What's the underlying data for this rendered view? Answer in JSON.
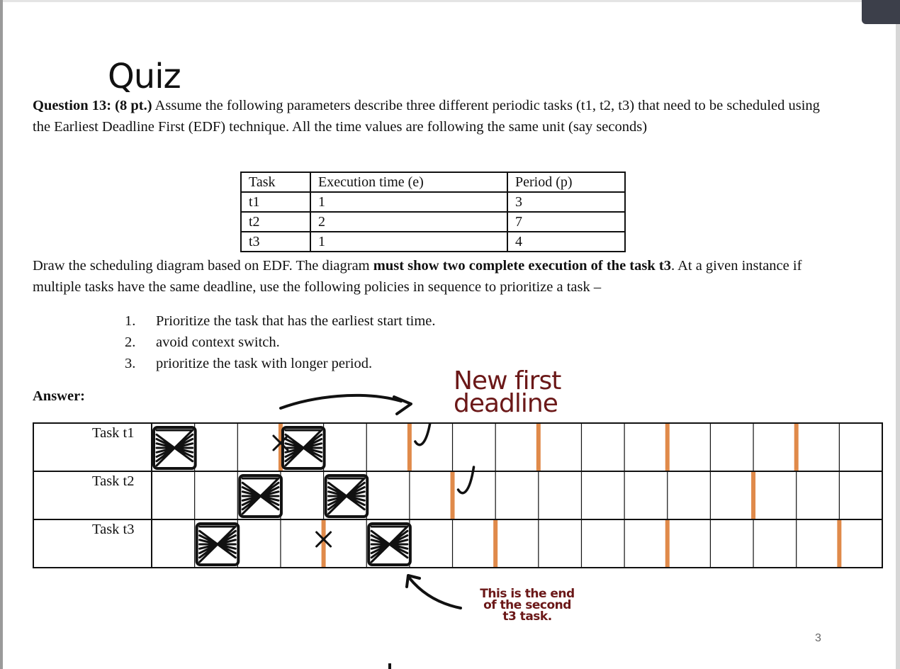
{
  "slide": {
    "title": "Quiz",
    "page_number": "3"
  },
  "question": {
    "label": "Question 13: (8 pt.)",
    "text": " Assume the following parameters describe three different periodic tasks (t1, t2, t3) that need to be scheduled using the Earliest Deadline First (EDF) technique. All the time values are following the same unit (say seconds)"
  },
  "params_table": {
    "headers": [
      "Task",
      "Execution time (e)",
      "Period (p)"
    ],
    "rows": [
      [
        "t1",
        "1",
        "3"
      ],
      [
        "t2",
        "2",
        "7"
      ],
      [
        "t3",
        "1",
        "4"
      ]
    ]
  },
  "instructions": {
    "part1": "Draw the scheduling diagram based on EDF. The diagram ",
    "bold": "must show two complete execution of the task t3",
    "part2": ". At a given instance if multiple tasks have the same deadline, use the following policies in sequence to prioritize a task –"
  },
  "policies": [
    {
      "num": "1.",
      "text": "Prioritize the task that has the earliest start time."
    },
    {
      "num": "2.",
      "text": "avoid context switch."
    },
    {
      "num": "3.",
      "text": "prioritize the task with longer period."
    }
  ],
  "answer_label": "Answer:",
  "schedule": {
    "row_labels": [
      "Task t1",
      "Task t2",
      "Task t3"
    ],
    "time_slots": 17,
    "filled_slots": [
      [
        0,
        3
      ],
      [
        2,
        4
      ],
      [
        1,
        5
      ]
    ],
    "deadline_markers": [
      [
        3,
        6,
        9,
        12,
        15
      ],
      [
        7,
        14
      ],
      [
        4,
        8,
        12,
        16
      ]
    ],
    "crossed_deadlines": [
      [
        3
      ],
      [],
      [
        4
      ]
    ],
    "checked_deadlines": [
      [
        6
      ],
      [
        7
      ],
      []
    ],
    "marker_color": "#e08a4a"
  },
  "annotations": {
    "new_deadline_line1": "New first",
    "new_deadline_line2": "deadline",
    "end_note_line1": "This is the end",
    "end_note_line2": "of the second",
    "end_note_line3": "t3 task."
  }
}
